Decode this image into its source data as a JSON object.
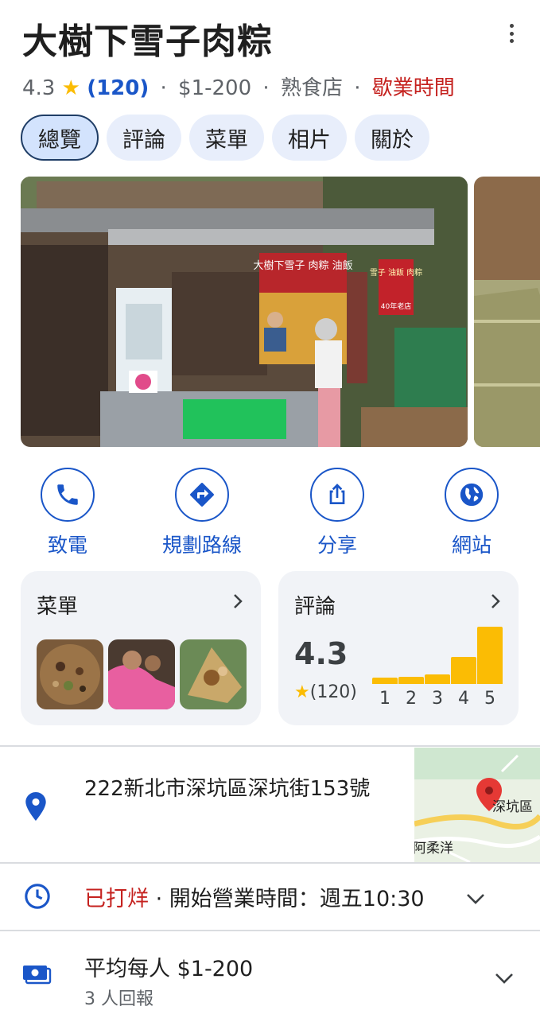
{
  "place": {
    "title": "大樹下雪子肉粽",
    "rating": "4.3",
    "star": "★",
    "review_count": "(120)",
    "price": "$1-200",
    "category": "熟食店",
    "status": "歇業時間",
    "separator": "·"
  },
  "tabs": [
    {
      "label": "總覽",
      "active": true
    },
    {
      "label": "評論",
      "active": false
    },
    {
      "label": "菜單",
      "active": false
    },
    {
      "label": "相片",
      "active": false
    },
    {
      "label": "關於",
      "active": false
    }
  ],
  "photo_signs": {
    "banner": "大樹下雪子 肉粽 油飯",
    "side_sign": "雪子 油飯 肉粽",
    "side_sign_sub": "40年老店"
  },
  "actions": [
    {
      "label": "致電",
      "icon": "phone-icon"
    },
    {
      "label": "規劃路線",
      "icon": "directions-icon"
    },
    {
      "label": "分享",
      "icon": "share-icon"
    },
    {
      "label": "網站",
      "icon": "globe-icon"
    }
  ],
  "menu_card": {
    "title": "菜單"
  },
  "reviews_card": {
    "title": "評論",
    "rating": "4.3",
    "star": "★",
    "count": "(120)",
    "distribution": {
      "labels": [
        "1",
        "2",
        "3",
        "4",
        "5"
      ],
      "values": [
        0.11,
        0.12,
        0.16,
        0.47,
        1.0
      ]
    }
  },
  "address": {
    "text": "222新北市深坑區深坑街153號"
  },
  "map": {
    "label_district": "深坑區",
    "label_area": "阿柔洋"
  },
  "hours": {
    "status": "已打烊",
    "separator": "·",
    "next": "開始營業時間：週五10:30"
  },
  "price_info": {
    "text": "平均每人 $1-200",
    "reports": "3 人回報"
  },
  "colors": {
    "accent": "#1a56c8",
    "closed_red": "#c5221f",
    "star": "#fbbc04",
    "card_bg": "#f1f3f7"
  }
}
